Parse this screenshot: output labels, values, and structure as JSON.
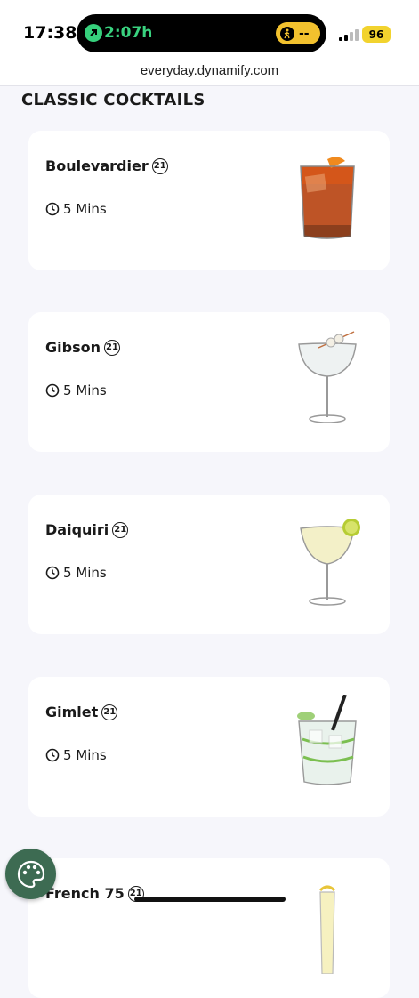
{
  "status_bar": {
    "time": "17:38",
    "live_activity": "2:07h",
    "activity_status": "--",
    "battery": "96"
  },
  "browser": {
    "url": "everyday.dynamify.com"
  },
  "section": {
    "title": "CLASSIC COCKTAILS"
  },
  "cocktails": [
    {
      "name": "Boulevardier",
      "age": "21",
      "duration": "5 Mins",
      "image": "old-fashioned-glass-red"
    },
    {
      "name": "Gibson",
      "age": "21",
      "duration": "5 Mins",
      "image": "coupe-glass-onion"
    },
    {
      "name": "Daiquiri",
      "age": "21",
      "duration": "5 Mins",
      "image": "martini-glass-lime"
    },
    {
      "name": "Gimlet",
      "age": "21",
      "duration": "5 Mins",
      "image": "rocks-glass-cucumber"
    },
    {
      "name": "French 75",
      "age": "21",
      "image": "flute-glass-lemon"
    }
  ],
  "fab": {
    "icon": "palette-icon",
    "color": "#3d6b52"
  }
}
